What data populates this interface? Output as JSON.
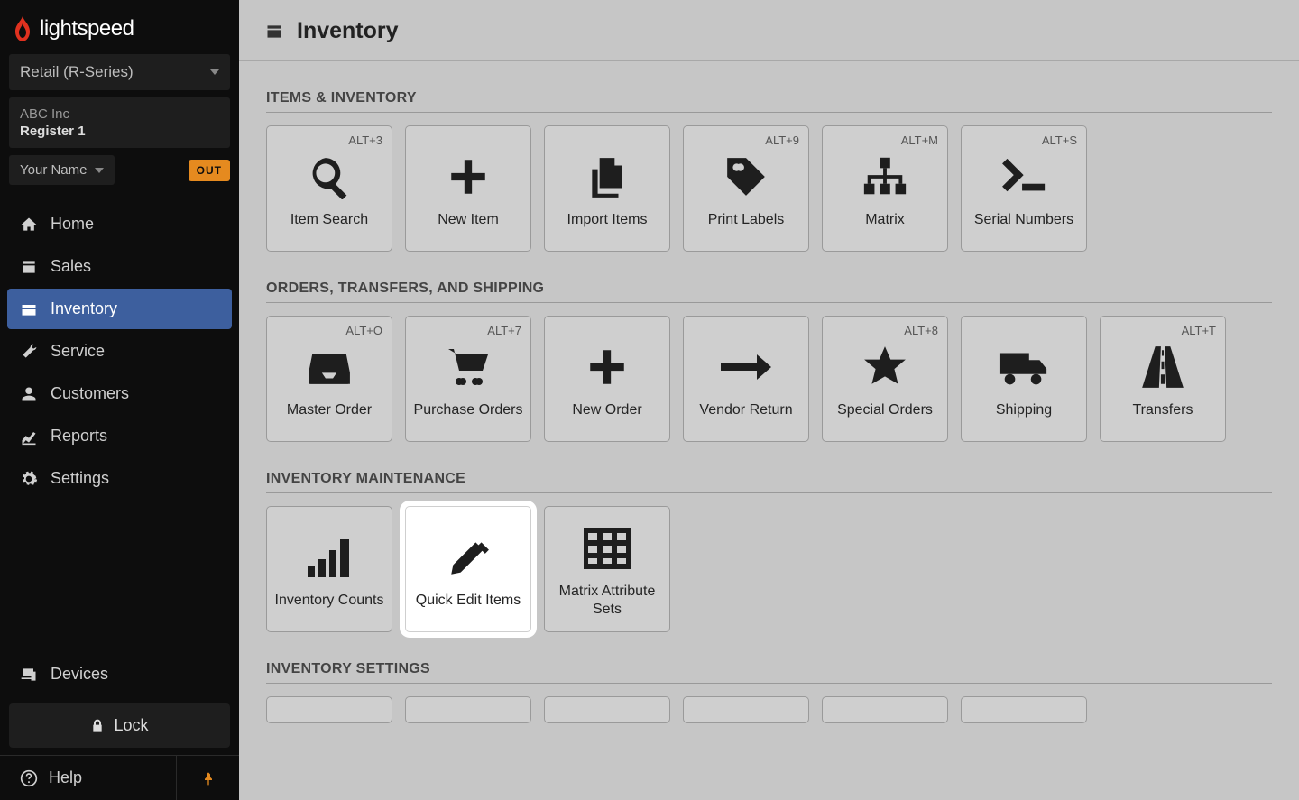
{
  "brand": "lightspeed",
  "product_selector": "Retail (R-Series)",
  "company": "ABC Inc",
  "register": "Register 1",
  "user": "Your Name",
  "out_badge": "OUT",
  "nav": {
    "home": "Home",
    "sales": "Sales",
    "inventory": "Inventory",
    "service": "Service",
    "customers": "Customers",
    "reports": "Reports",
    "settings": "Settings"
  },
  "devices": "Devices",
  "lock": "Lock",
  "help": "Help",
  "page_title": "Inventory",
  "sections": {
    "items": {
      "title": "ITEMS & INVENTORY",
      "cards": {
        "item_search": {
          "label": "Item Search",
          "shortcut": "ALT+3"
        },
        "new_item": {
          "label": "New Item",
          "shortcut": ""
        },
        "import_items": {
          "label": "Import Items",
          "shortcut": ""
        },
        "print_labels": {
          "label": "Print Labels",
          "shortcut": "ALT+9"
        },
        "matrix": {
          "label": "Matrix",
          "shortcut": "ALT+M"
        },
        "serial_numbers": {
          "label": "Serial Numbers",
          "shortcut": "ALT+S"
        }
      }
    },
    "orders": {
      "title": "ORDERS, TRANSFERS, AND SHIPPING",
      "cards": {
        "master_order": {
          "label": "Master Order",
          "shortcut": "ALT+O"
        },
        "purchase_orders": {
          "label": "Purchase Orders",
          "shortcut": "ALT+7"
        },
        "new_order": {
          "label": "New Order",
          "shortcut": ""
        },
        "vendor_return": {
          "label": "Vendor Return",
          "shortcut": ""
        },
        "special_orders": {
          "label": "Special Orders",
          "shortcut": "ALT+8"
        },
        "shipping": {
          "label": "Shipping",
          "shortcut": ""
        },
        "transfers": {
          "label": "Transfers",
          "shortcut": "ALT+T"
        }
      }
    },
    "maintenance": {
      "title": "INVENTORY MAINTENANCE",
      "cards": {
        "inventory_counts": {
          "label": "Inventory Counts",
          "shortcut": ""
        },
        "quick_edit": {
          "label": "Quick Edit Items",
          "shortcut": ""
        },
        "matrix_attr": {
          "label": "Matrix Attribute Sets",
          "shortcut": ""
        }
      }
    },
    "settings": {
      "title": "INVENTORY SETTINGS"
    }
  }
}
